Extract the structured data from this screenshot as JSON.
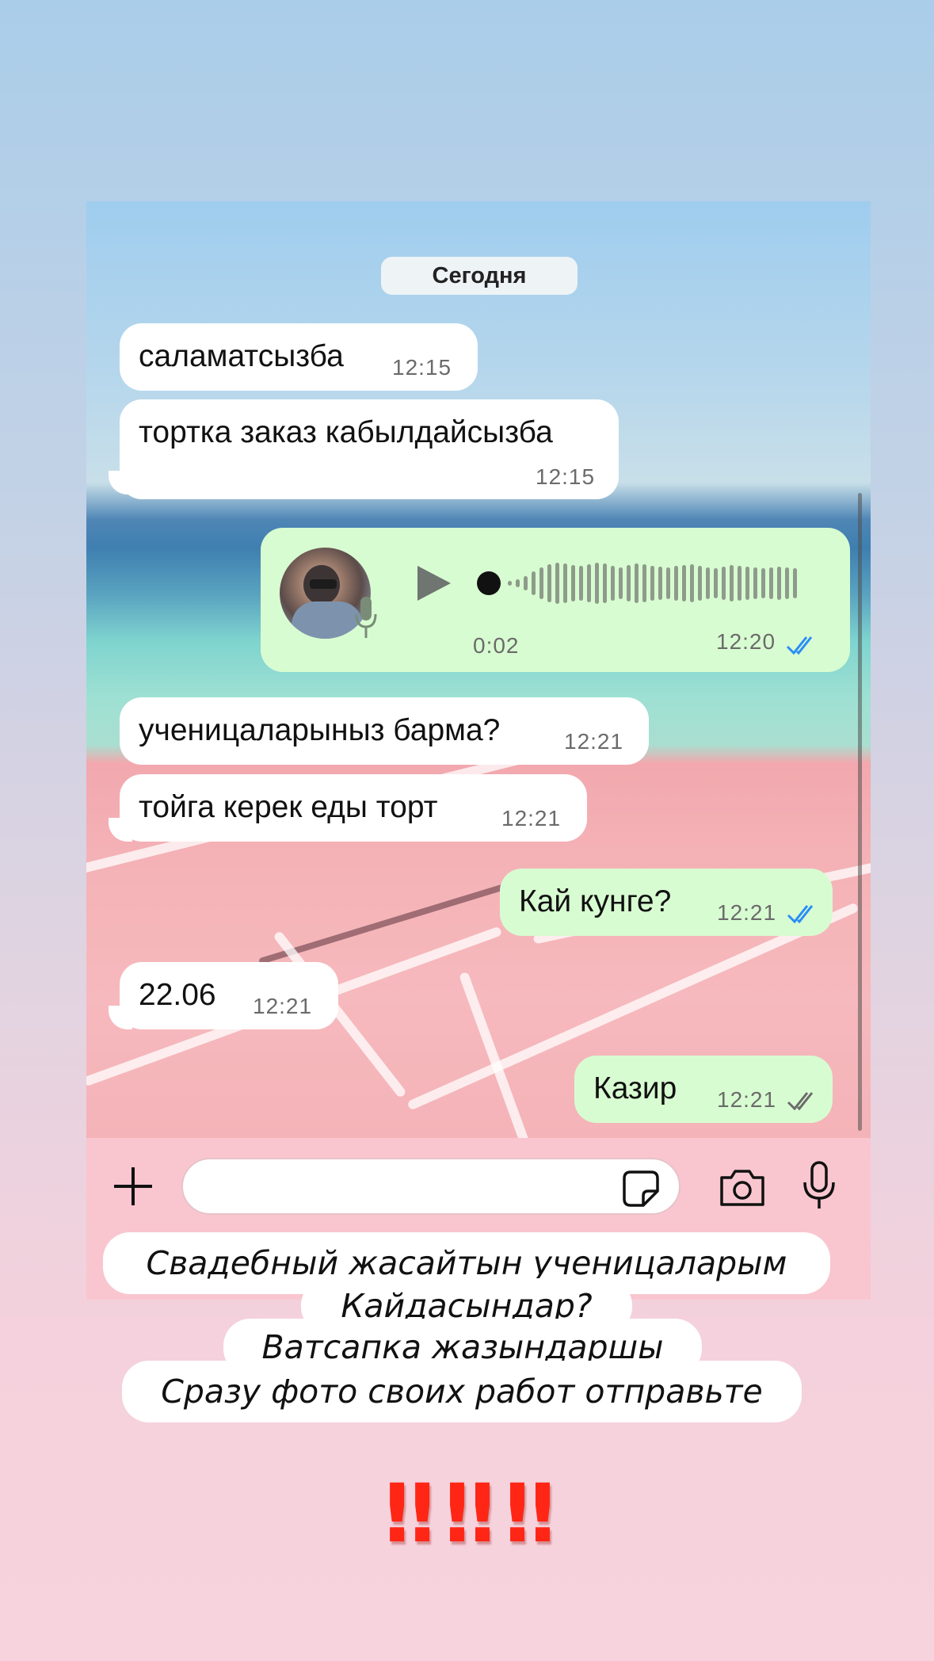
{
  "chat": {
    "date_label": "Сегодня",
    "messages": [
      {
        "id": "m1",
        "dir": "in",
        "text": "саламатсызба",
        "time": "12:15"
      },
      {
        "id": "m2",
        "dir": "in",
        "text": "тортка заказ кабылдайсызба",
        "time": "12:15"
      },
      {
        "id": "m3",
        "dir": "out",
        "type": "voice",
        "duration": "0:02",
        "time": "12:20",
        "status": "read"
      },
      {
        "id": "m4",
        "dir": "in",
        "text": "ученицаларыныз барма?",
        "time": "12:21"
      },
      {
        "id": "m5",
        "dir": "in",
        "text": "тойга керек еды торт",
        "time": "12:21"
      },
      {
        "id": "m6",
        "dir": "out",
        "text": "Кай кунге?",
        "time": "12:21",
        "status": "read"
      },
      {
        "id": "m7",
        "dir": "in",
        "text": "22.06",
        "time": "12:21"
      },
      {
        "id": "m8",
        "dir": "out",
        "text": "Казир",
        "time": "12:21",
        "status": "delivered"
      }
    ]
  },
  "input_bar": {
    "icons": [
      "plus-icon",
      "sticker-icon",
      "camera-icon",
      "microphone-icon"
    ],
    "value": ""
  },
  "captions": [
    "Свадебный жасайтын ученицаларым",
    "Кайдасындар?",
    "Ватсапка жазындаршы",
    "Сразу фото своих работ отправьте"
  ],
  "alert_marks": [
    "‼",
    "‼",
    "‼"
  ],
  "colors": {
    "bubble_in": "#ffffff",
    "bubble_out": "#d8fcd1",
    "read_checks": "#2a8df7",
    "delivered_checks": "#6b6b6b",
    "alert": "#ff2616"
  }
}
